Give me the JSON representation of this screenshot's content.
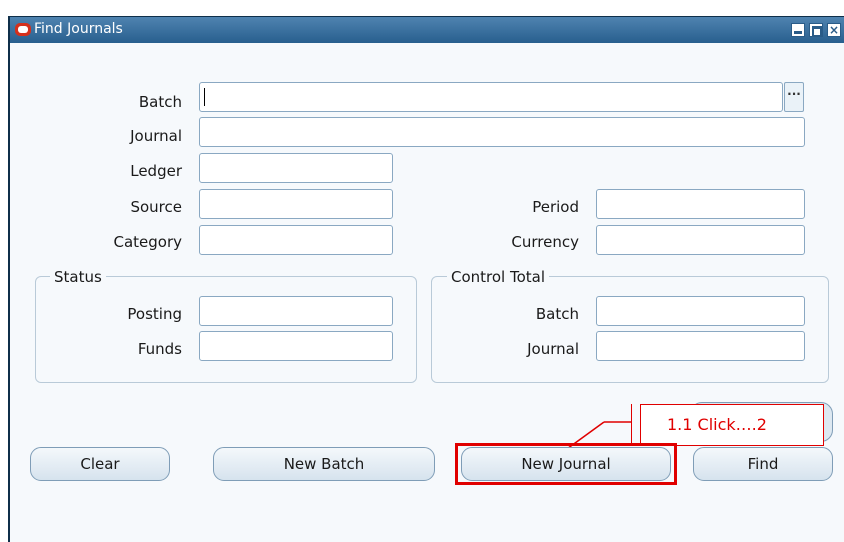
{
  "window": {
    "title": "Find Journals"
  },
  "icons": {
    "app_logo": "oracle-logo-icon",
    "minimize": "minimize-icon",
    "maximize": "maximize-icon",
    "close": "close-icon",
    "lov": "ellipsis-icon"
  },
  "fields": {
    "batch": {
      "label": "Batch",
      "value": ""
    },
    "journal": {
      "label": "Journal",
      "value": ""
    },
    "ledger": {
      "label": "Ledger",
      "value": ""
    },
    "source": {
      "label": "Source",
      "value": ""
    },
    "category": {
      "label": "Category",
      "value": ""
    },
    "period": {
      "label": "Period",
      "value": ""
    },
    "currency": {
      "label": "Currency",
      "value": ""
    }
  },
  "status_group": {
    "title": "Status",
    "posting": {
      "label": "Posting",
      "value": ""
    },
    "funds": {
      "label": "Funds",
      "value": ""
    }
  },
  "control_total_group": {
    "title": "Control Total",
    "batch": {
      "label": "Batch",
      "value": ""
    },
    "journal": {
      "label": "Journal",
      "value": ""
    }
  },
  "buttons": {
    "clear": "Clear",
    "new_batch": "New Batch",
    "new_journal": "New Journal",
    "find": "Find"
  },
  "callout": {
    "text": "1.1 Click….2",
    "color": "#e00000"
  },
  "colors": {
    "titlebar": "#285f8e",
    "highlight": "#e00000"
  }
}
